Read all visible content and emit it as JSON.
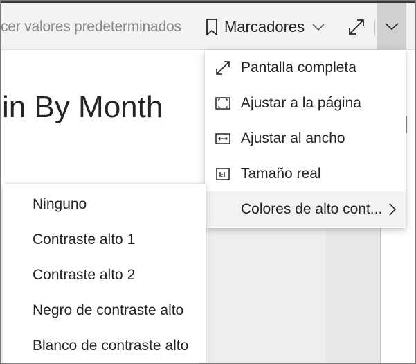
{
  "toolbar": {
    "reset_label": "cer valores predeterminados",
    "bookmarks_label": "Marcadores"
  },
  "report": {
    "title": "in By Month"
  },
  "view_menu": {
    "items": [
      {
        "label": "Pantalla completa",
        "icon": "fullscreen-icon"
      },
      {
        "label": "Ajustar a la página",
        "icon": "fit-page-icon"
      },
      {
        "label": "Ajustar al ancho",
        "icon": "fit-width-icon"
      },
      {
        "label": "Tamaño real",
        "icon": "actual-size-icon"
      },
      {
        "label": "Colores de alto cont...",
        "icon": "chevron-right-icon"
      }
    ]
  },
  "contrast_menu": {
    "items": [
      {
        "label": "Ninguno"
      },
      {
        "label": "Contraste alto 1"
      },
      {
        "label": "Contraste alto 2"
      },
      {
        "label": "Negro de contraste alto"
      },
      {
        "label": "Blanco de contraste alto"
      }
    ]
  },
  "colors": {
    "toolbar_bg": "#f3f2f1",
    "active_button_bg": "#d2d0ce",
    "text": "#252423",
    "muted_text": "#8a8886"
  }
}
